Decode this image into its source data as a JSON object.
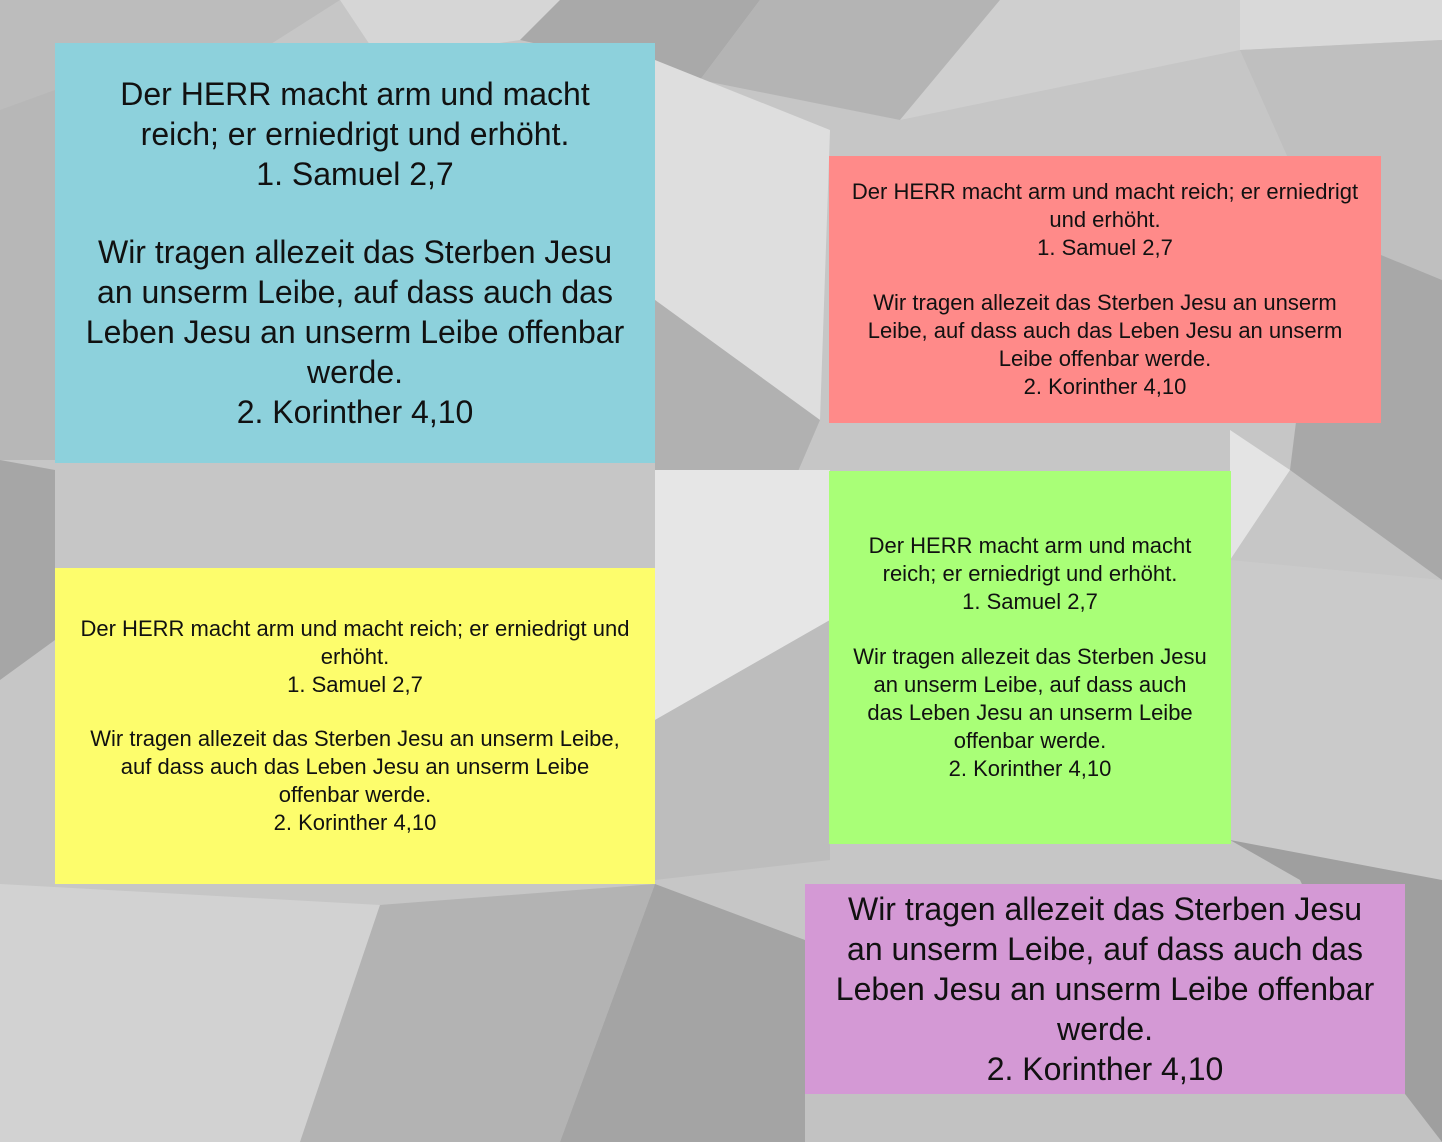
{
  "colors": {
    "background": "#c9c9c9",
    "blue": "#8dd1dc",
    "red": "#ff8a89",
    "yellow": "#fdfd6c",
    "green": "#a9ff77",
    "purple": "#d499d5",
    "text": "#111111"
  },
  "cards": {
    "blue": {
      "verse1": "Der HERR macht arm und macht reich; er erniedrigt und erhöht.",
      "ref1": "1. Samuel 2,7",
      "verse2": "Wir tragen allezeit das Sterben Jesu an unserm Leibe, auf dass auch das Leben Jesu an unserm Leibe offenbar werde.",
      "ref2": "2. Korinther 4,10"
    },
    "red": {
      "verse1": "Der HERR macht arm und macht reich; er erniedrigt und erhöht.",
      "ref1": "1. Samuel 2,7",
      "verse2": "Wir tragen allezeit das Sterben Jesu an unserm Leibe, auf dass auch das Leben Jesu an unserm Leibe offenbar werde.",
      "ref2": "2. Korinther 4,10"
    },
    "yellow": {
      "verse1": "Der HERR macht arm und macht reich; er erniedrigt und erhöht.",
      "ref1": "1. Samuel 2,7",
      "verse2": "Wir tragen allezeit das Sterben Jesu an unserm Leibe, auf dass auch das Leben Jesu an unserm Leibe offenbar werde.",
      "ref2": "2. Korinther 4,10"
    },
    "green": {
      "verse1": "Der HERR macht arm und macht reich; er erniedrigt und erhöht.",
      "ref1": "1. Samuel 2,7",
      "verse2": "Wir tragen allezeit das Sterben Jesu an unserm Leibe, auf dass auch das Leben Jesu an unserm Leibe offenbar werde.",
      "ref2": "2. Korinther 4,10"
    },
    "purple": {
      "verse2": "Wir tragen allezeit das Sterben Jesu an unserm Leibe, auf dass auch das Leben Jesu an unserm Leibe offenbar werde.",
      "ref2": "2. Korinther 4,10"
    }
  }
}
